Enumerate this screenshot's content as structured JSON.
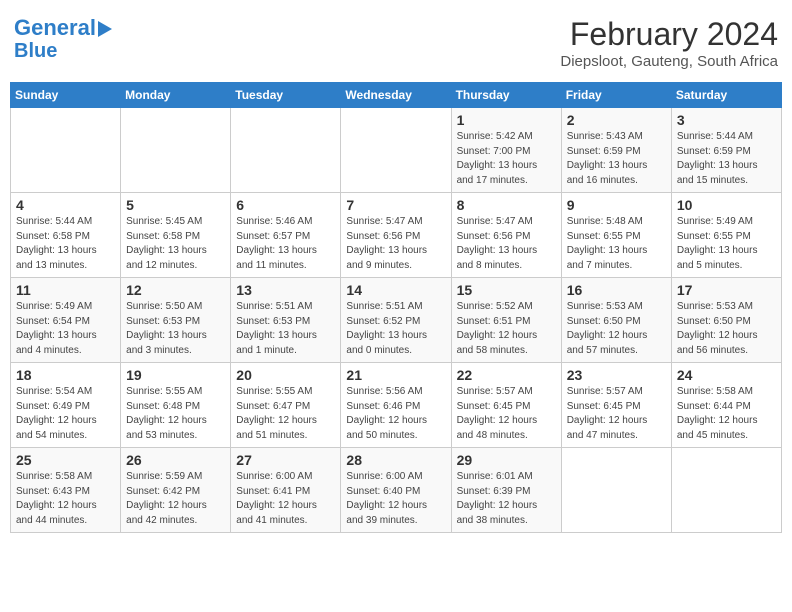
{
  "header": {
    "logo_line1": "General",
    "logo_line2": "Blue",
    "month": "February 2024",
    "location": "Diepsloot, Gauteng, South Africa"
  },
  "days_of_week": [
    "Sunday",
    "Monday",
    "Tuesday",
    "Wednesday",
    "Thursday",
    "Friday",
    "Saturday"
  ],
  "weeks": [
    [
      {
        "day": "",
        "info": ""
      },
      {
        "day": "",
        "info": ""
      },
      {
        "day": "",
        "info": ""
      },
      {
        "day": "",
        "info": ""
      },
      {
        "day": "1",
        "info": "Sunrise: 5:42 AM\nSunset: 7:00 PM\nDaylight: 13 hours\nand 17 minutes."
      },
      {
        "day": "2",
        "info": "Sunrise: 5:43 AM\nSunset: 6:59 PM\nDaylight: 13 hours\nand 16 minutes."
      },
      {
        "day": "3",
        "info": "Sunrise: 5:44 AM\nSunset: 6:59 PM\nDaylight: 13 hours\nand 15 minutes."
      }
    ],
    [
      {
        "day": "4",
        "info": "Sunrise: 5:44 AM\nSunset: 6:58 PM\nDaylight: 13 hours\nand 13 minutes."
      },
      {
        "day": "5",
        "info": "Sunrise: 5:45 AM\nSunset: 6:58 PM\nDaylight: 13 hours\nand 12 minutes."
      },
      {
        "day": "6",
        "info": "Sunrise: 5:46 AM\nSunset: 6:57 PM\nDaylight: 13 hours\nand 11 minutes."
      },
      {
        "day": "7",
        "info": "Sunrise: 5:47 AM\nSunset: 6:56 PM\nDaylight: 13 hours\nand 9 minutes."
      },
      {
        "day": "8",
        "info": "Sunrise: 5:47 AM\nSunset: 6:56 PM\nDaylight: 13 hours\nand 8 minutes."
      },
      {
        "day": "9",
        "info": "Sunrise: 5:48 AM\nSunset: 6:55 PM\nDaylight: 13 hours\nand 7 minutes."
      },
      {
        "day": "10",
        "info": "Sunrise: 5:49 AM\nSunset: 6:55 PM\nDaylight: 13 hours\nand 5 minutes."
      }
    ],
    [
      {
        "day": "11",
        "info": "Sunrise: 5:49 AM\nSunset: 6:54 PM\nDaylight: 13 hours\nand 4 minutes."
      },
      {
        "day": "12",
        "info": "Sunrise: 5:50 AM\nSunset: 6:53 PM\nDaylight: 13 hours\nand 3 minutes."
      },
      {
        "day": "13",
        "info": "Sunrise: 5:51 AM\nSunset: 6:53 PM\nDaylight: 13 hours\nand 1 minute."
      },
      {
        "day": "14",
        "info": "Sunrise: 5:51 AM\nSunset: 6:52 PM\nDaylight: 13 hours\nand 0 minutes."
      },
      {
        "day": "15",
        "info": "Sunrise: 5:52 AM\nSunset: 6:51 PM\nDaylight: 12 hours\nand 58 minutes."
      },
      {
        "day": "16",
        "info": "Sunrise: 5:53 AM\nSunset: 6:50 PM\nDaylight: 12 hours\nand 57 minutes."
      },
      {
        "day": "17",
        "info": "Sunrise: 5:53 AM\nSunset: 6:50 PM\nDaylight: 12 hours\nand 56 minutes."
      }
    ],
    [
      {
        "day": "18",
        "info": "Sunrise: 5:54 AM\nSunset: 6:49 PM\nDaylight: 12 hours\nand 54 minutes."
      },
      {
        "day": "19",
        "info": "Sunrise: 5:55 AM\nSunset: 6:48 PM\nDaylight: 12 hours\nand 53 minutes."
      },
      {
        "day": "20",
        "info": "Sunrise: 5:55 AM\nSunset: 6:47 PM\nDaylight: 12 hours\nand 51 minutes."
      },
      {
        "day": "21",
        "info": "Sunrise: 5:56 AM\nSunset: 6:46 PM\nDaylight: 12 hours\nand 50 minutes."
      },
      {
        "day": "22",
        "info": "Sunrise: 5:57 AM\nSunset: 6:45 PM\nDaylight: 12 hours\nand 48 minutes."
      },
      {
        "day": "23",
        "info": "Sunrise: 5:57 AM\nSunset: 6:45 PM\nDaylight: 12 hours\nand 47 minutes."
      },
      {
        "day": "24",
        "info": "Sunrise: 5:58 AM\nSunset: 6:44 PM\nDaylight: 12 hours\nand 45 minutes."
      }
    ],
    [
      {
        "day": "25",
        "info": "Sunrise: 5:58 AM\nSunset: 6:43 PM\nDaylight: 12 hours\nand 44 minutes."
      },
      {
        "day": "26",
        "info": "Sunrise: 5:59 AM\nSunset: 6:42 PM\nDaylight: 12 hours\nand 42 minutes."
      },
      {
        "day": "27",
        "info": "Sunrise: 6:00 AM\nSunset: 6:41 PM\nDaylight: 12 hours\nand 41 minutes."
      },
      {
        "day": "28",
        "info": "Sunrise: 6:00 AM\nSunset: 6:40 PM\nDaylight: 12 hours\nand 39 minutes."
      },
      {
        "day": "29",
        "info": "Sunrise: 6:01 AM\nSunset: 6:39 PM\nDaylight: 12 hours\nand 38 minutes."
      },
      {
        "day": "",
        "info": ""
      },
      {
        "day": "",
        "info": ""
      }
    ]
  ]
}
